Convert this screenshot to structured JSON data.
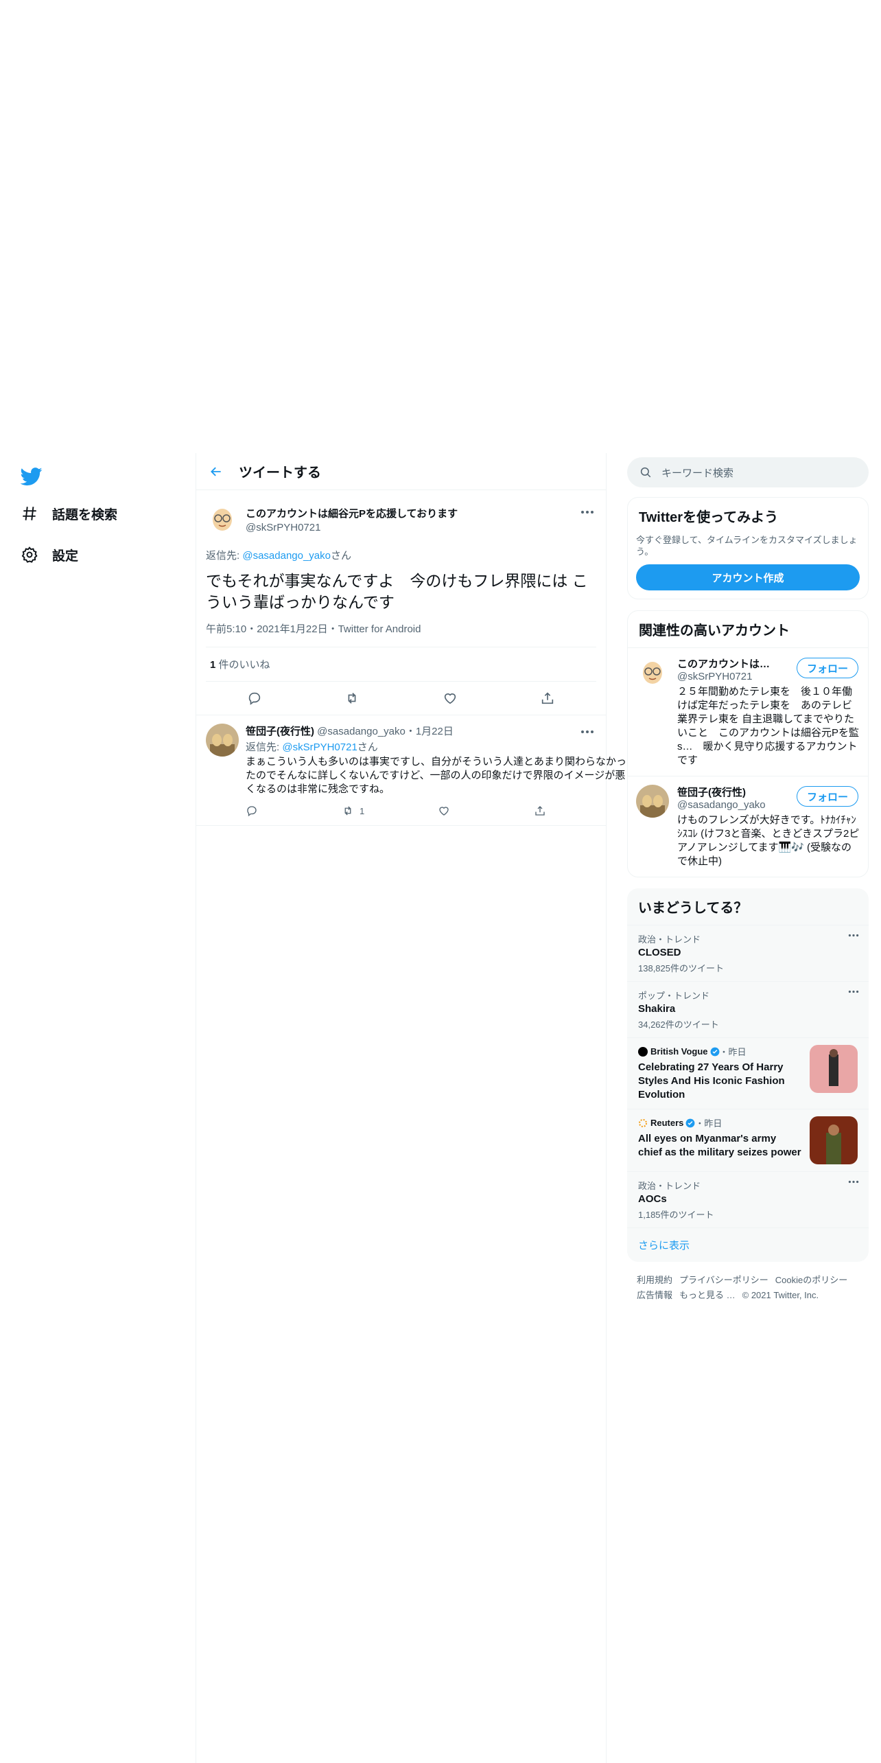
{
  "nav": {
    "items": [
      {
        "label": "話題を検索"
      },
      {
        "label": "設定"
      }
    ]
  },
  "header": {
    "title": "ツイートする"
  },
  "main_tweet": {
    "name": "このアカウントは細谷元Pを応援しております",
    "handle": "@skSrPYH0721",
    "reply_prefix": "返信先: ",
    "reply_mention": "@sasadango_yako",
    "reply_suffix": "さん",
    "text": "でもそれが事実なんですよ　今のけもフレ界隈には こういう輩ばっかりなんです",
    "meta": "午前5:10・2021年1月22日・Twitter for Android",
    "likes_count": "1",
    "likes_label": " 件のいいね"
  },
  "reply": {
    "name": "笹団子(夜行性)",
    "handle_time": " @sasadango_yako・1月22日",
    "reply_prefix": "返信先: ",
    "reply_mention": "@skSrPYH0721",
    "reply_suffix": "さん",
    "text": "まぁこういう人も多いのは事実ですし、自分がそういう人達とあまり関わらなかったのでそんなに詳しくないんですけど、一部の人の印象だけで界限のイメージが悪くなるのは非常に残念ですね。",
    "retweets": "1"
  },
  "search": {
    "placeholder": "キーワード検索"
  },
  "signup": {
    "title": "Twitterを使ってみよう",
    "desc": "今すぐ登録して、タイムラインをカスタマイズしましょう。",
    "button": "アカウント作成"
  },
  "related": {
    "title": "関連性の高いアカウント",
    "accounts": [
      {
        "name": "このアカウントは細谷元Pを応援しております",
        "handle": "@skSrPYH0721",
        "bio": "２５年間勤めたテレ東を　後１０年働けば定年だったテレ東を　あのテレビ業界テレ東を 自主退職してまでやりたいこと　このアカウントは細谷元Pを監s…　暖かく見守り応援するアカウントです",
        "follow": "フォロー"
      },
      {
        "name": "笹団子(夜行性)",
        "handle": "@sasadango_yako",
        "bio": "けものフレンズが大好きです。ﾄﾅｶｲﾁｬﾝｼｽｺﾚ (けフ3と音楽、ときどきスプラ2ピアノアレンジしてます🎹🎶 (受験なので休止中)",
        "follow": "フォロー"
      }
    ]
  },
  "trends": {
    "title": "いまどうしてる？",
    "items": [
      {
        "context": "政治・トレンド",
        "title": "CLOSED",
        "count": "138,825件のツイート"
      },
      {
        "context": "ポップ・トレンド",
        "title": "Shakira",
        "count": "34,262件のツイート"
      }
    ],
    "news": [
      {
        "source": "British Vogue",
        "time": "・昨日",
        "headline": "Celebrating 27 Years Of Harry Styles And His Iconic Fashion Evolution"
      },
      {
        "source": "Reuters",
        "time": "・昨日",
        "headline": "All eyes on Myanmar's army chief as the military seizes power"
      }
    ],
    "last": {
      "context": "政治・トレンド",
      "title": "AOCs",
      "count": "1,185件のツイート"
    },
    "show_more": "さらに表示"
  },
  "footer": {
    "links": [
      "利用規約",
      "プライバシーポリシー",
      "Cookieのポリシー",
      "広告情報",
      "もっと見る …"
    ],
    "copyright": "© 2021 Twitter, Inc."
  },
  "colors": {
    "accent": "#1d9bf0",
    "secondary_text": "#536471",
    "border": "#eff3f4"
  }
}
